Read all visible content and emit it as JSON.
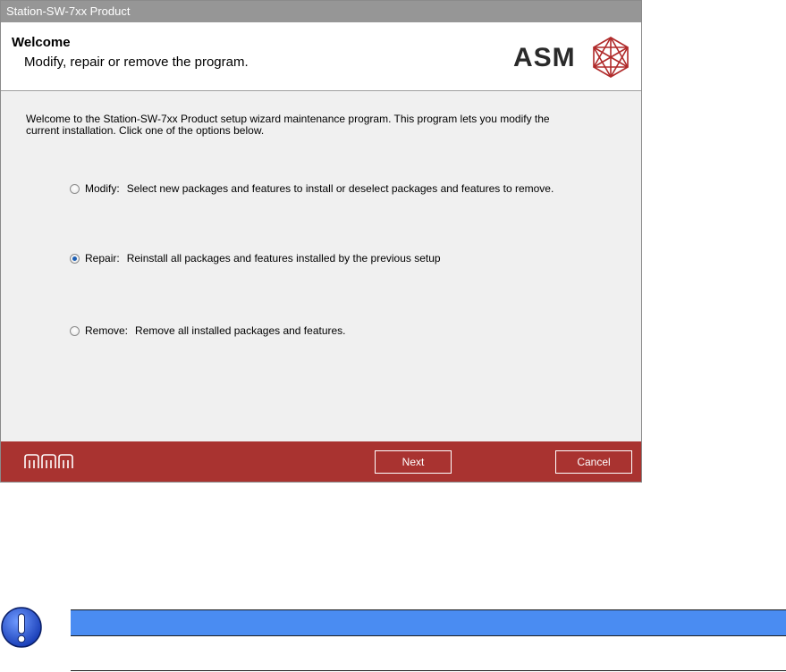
{
  "window": {
    "title": "Station-SW-7xx Product"
  },
  "header": {
    "title": "Welcome",
    "subtitle": "Modify, repair or remove the program.",
    "logo_text": "ASM"
  },
  "intro": {
    "text": "Welcome to the Station-SW-7xx Product setup wizard maintenance program. This program lets you modify the current installation. Click one of the options below."
  },
  "options": [
    {
      "label": "Modify:",
      "description": "Select new packages and features to install or deselect packages and features to remove.",
      "checked": false
    },
    {
      "label": "Repair:",
      "description": "Reinstall all packages and features installed by the previous setup",
      "checked": true
    },
    {
      "label": "Remove:",
      "description": "Remove all installed packages and features.",
      "checked": false
    }
  ],
  "footer": {
    "next_label": "Next",
    "cancel_label": "Cancel"
  },
  "colors": {
    "footer_bg": "#a93330",
    "titlebar_bg": "#969696",
    "note_bar": "#4a8cf2",
    "note_icon": "#1a4fd0",
    "logo_red": "#b02a2a"
  },
  "icons": {
    "note": "exclamation-icon",
    "radio_checked": "radio-checked-icon",
    "radio_unchecked": "radio-unchecked-icon",
    "footer_logo": "asm-footer-logo",
    "header_logo": "asm-hexagon-logo"
  }
}
